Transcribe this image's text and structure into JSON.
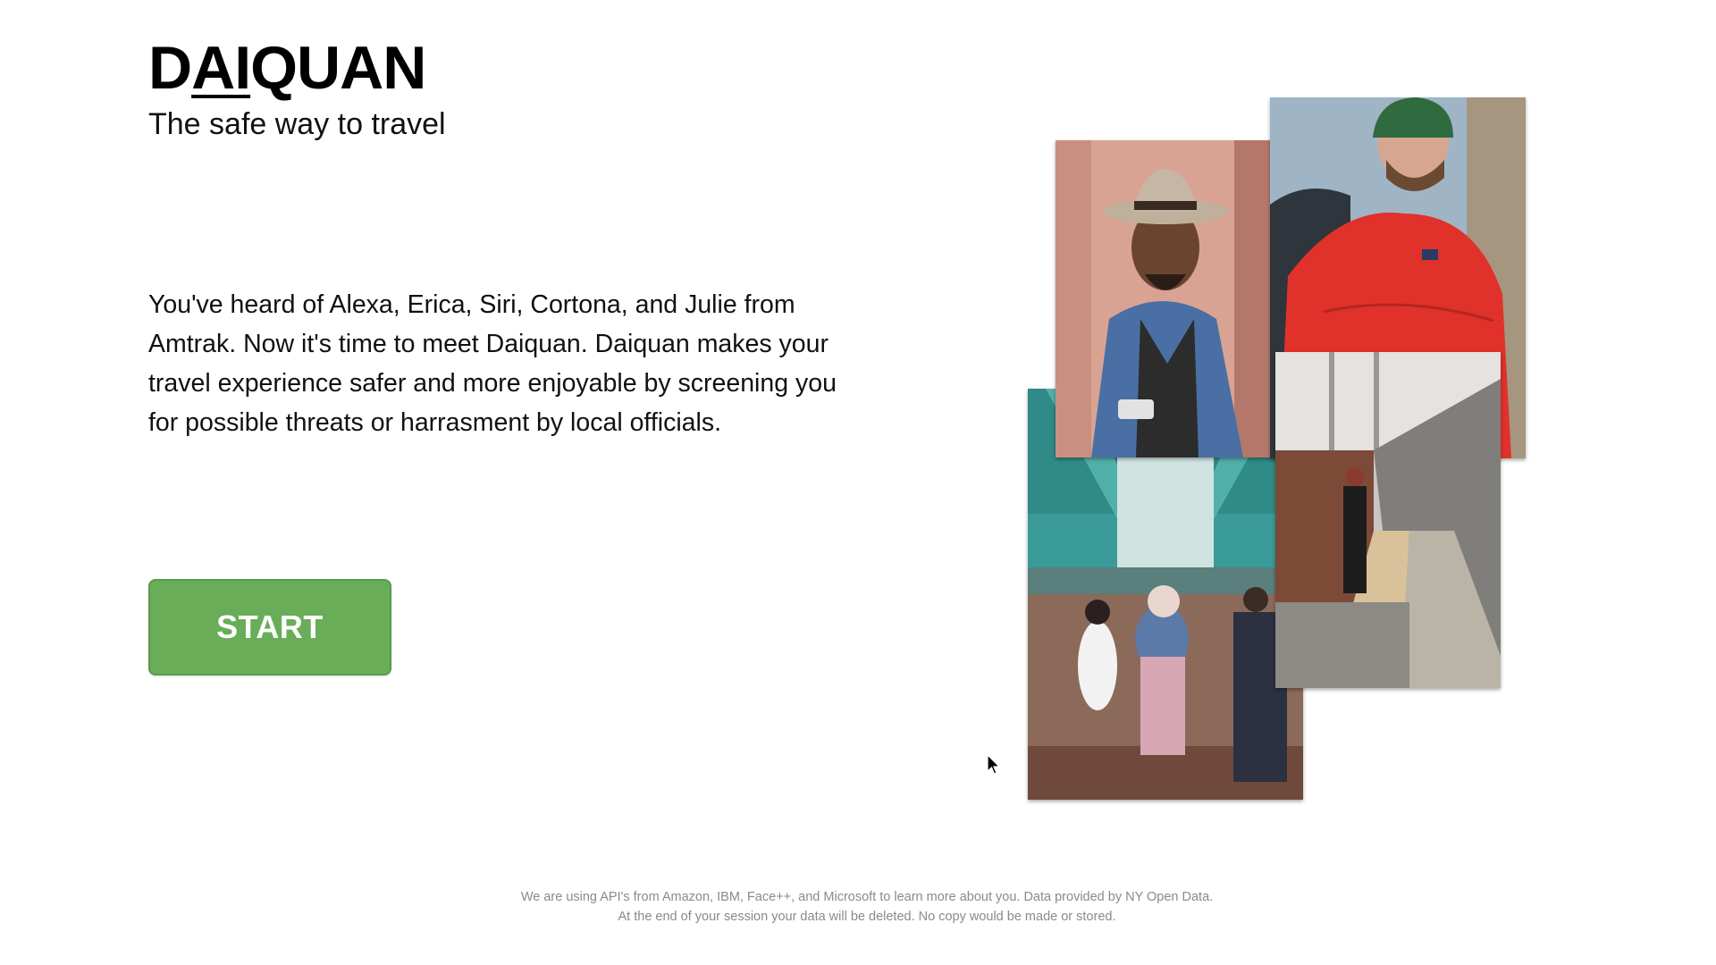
{
  "brand": {
    "logo_prefix": "D",
    "logo_ai": "AI",
    "logo_suffix": "QUAN",
    "tagline": "The safe way to travel"
  },
  "intro": {
    "text": "You've heard of Alexa, Erica, Siri, Cortona, and Julie from Amtrak. Now it's time to meet Daiquan. Daiquan makes your travel experience safer and more enjoyable by screening you for possible threats or harrasment by local officials."
  },
  "actions": {
    "start_label": "START"
  },
  "footer": {
    "line1": "We are using API's from Amazon, IBM, Face++, and Microsoft to learn more about you. Data provided by NY Open Data.",
    "line2": "At the end of your session your data will be deleted. No copy would be made or stored."
  },
  "colors": {
    "start_button": "#69ad58",
    "footer_text": "#8a8a8a",
    "text": "#111111"
  },
  "collage": {
    "photos": [
      "man-in-hat-photo",
      "hiker-red-jacket-photo",
      "elevated-station-crowd-photo",
      "subway-platform-photo"
    ]
  }
}
